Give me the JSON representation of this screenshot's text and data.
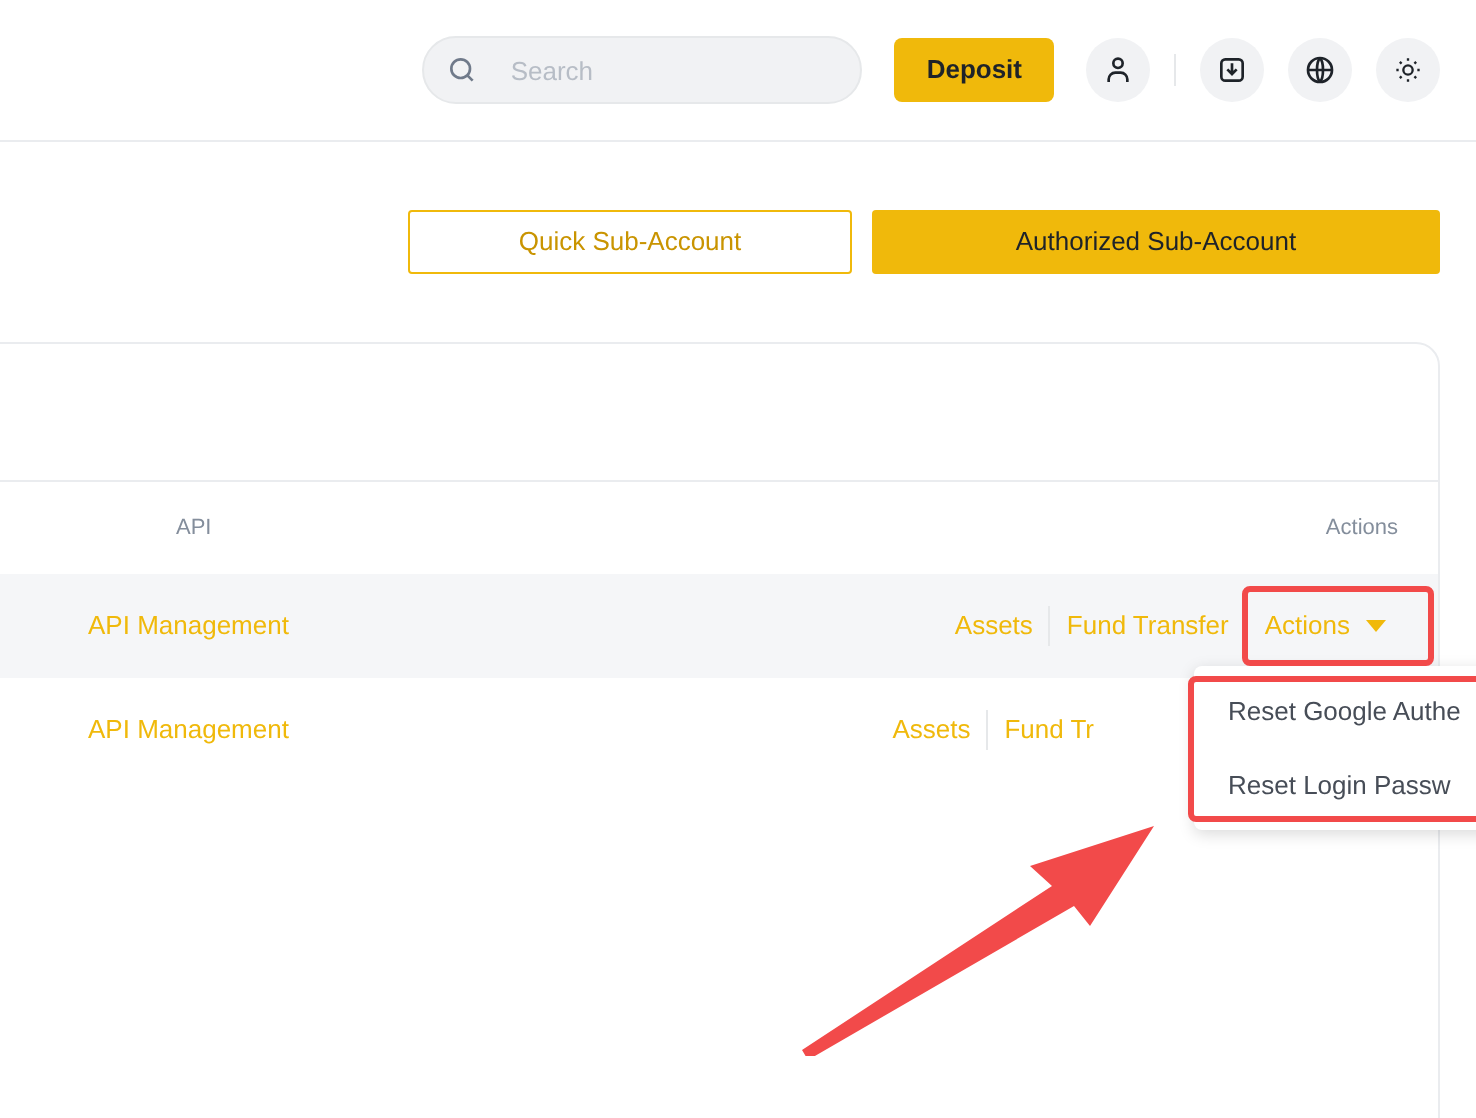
{
  "header": {
    "search": {
      "placeholder": "Search"
    },
    "deposit_button": "Deposit"
  },
  "account_buttons": [
    {
      "label": "Quick Sub-Account",
      "selected": false
    },
    {
      "label": "Authorized Sub-Account",
      "selected": true
    }
  ],
  "table": {
    "columns": [
      "API",
      "Actions"
    ],
    "rows": [
      {
        "api": "API Management",
        "highlighted": true,
        "actions": [
          "Assets",
          "Fund Transfer"
        ],
        "menu_button": "Actions"
      },
      {
        "api": "API Management",
        "highlighted": false,
        "actions": [
          "Assets",
          "Fund Tr"
        ]
      }
    ]
  },
  "dropdown": {
    "items": [
      "Reset Google Authe",
      "Reset Login Passw"
    ]
  }
}
